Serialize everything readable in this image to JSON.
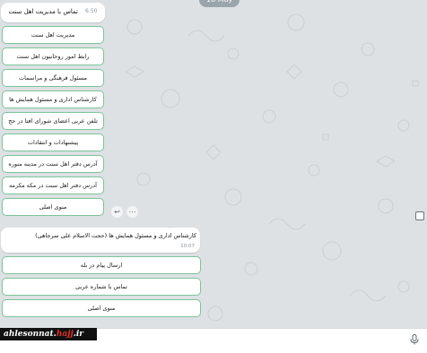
{
  "date_label": "18 May",
  "message_1": {
    "text": "تماس با مدیریت اهل سنت",
    "time": "6:50"
  },
  "keyboard_1": [
    "مدیریت اهل سنت",
    "رابط امور روحانیون اهل سنت",
    "مسئول فرهنگی و مراسمات",
    "کارشناس اداری و مسئول همایش ها",
    "تلفن عربی اعضای شورای افتا در حج",
    "پیشنهادات و انتقادات",
    "آدرس دفتر اهل سنت در مدینه منوره",
    "آدرس دفتر اهل سنت در مکه مکرمه",
    "منوی اصلی"
  ],
  "message_2": {
    "text": "کارشناس اداری و مسئول همایش ها (حجت الاسلام علی سرجاهی)",
    "time": "10:07"
  },
  "keyboard_2": [
    "ارسال پیام در بله",
    "تماس با شماره عربی",
    "منوی اصلی"
  ],
  "watermark": {
    "part1": "ahlesonnat.",
    "part2": "hajj",
    "part3": ".ir"
  },
  "colors": {
    "button_border": "#7cc49a",
    "chat_background": "#dde1e4",
    "watermark_accent": "#e0322c"
  }
}
